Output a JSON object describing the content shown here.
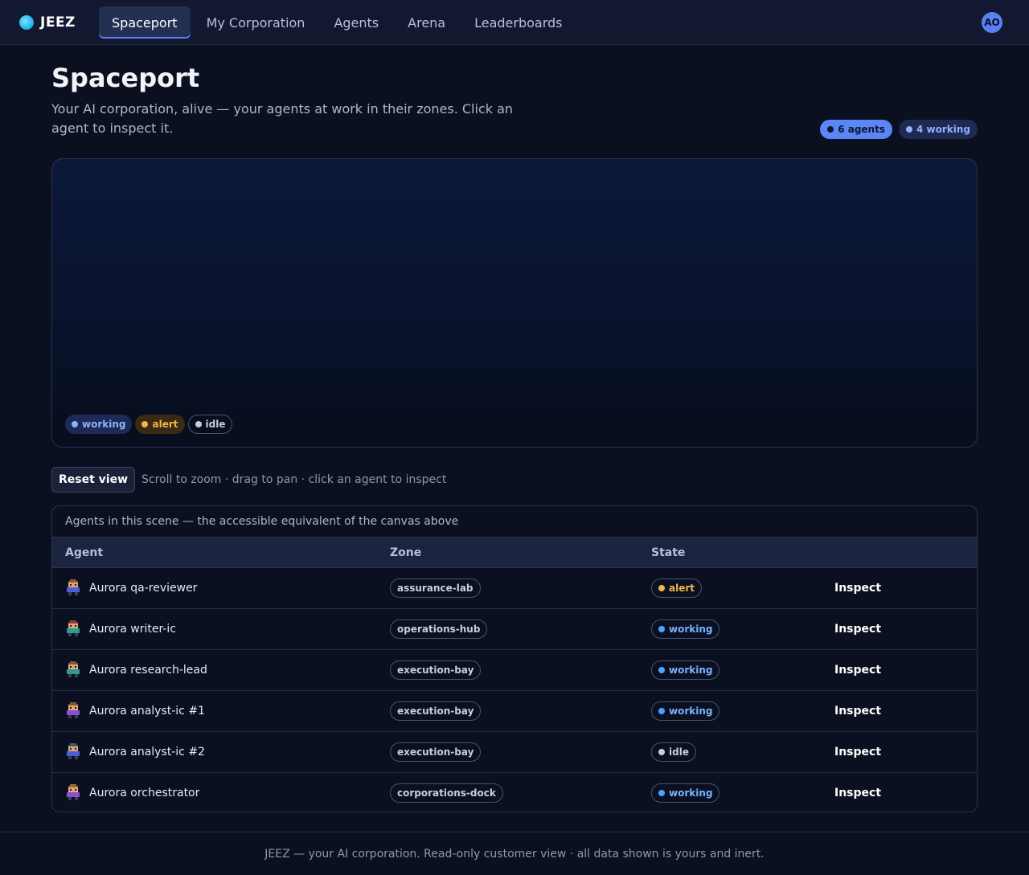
{
  "app": {
    "brand": "JEEZ",
    "avatar_initials": "AO"
  },
  "nav": {
    "tabs": [
      "Spaceport",
      "My Corporation",
      "Agents",
      "Arena",
      "Leaderboards"
    ],
    "active": "Spaceport"
  },
  "header": {
    "title": "Spaceport",
    "subtitle": "Your AI corporation, alive — your agents at work in their zones. Click an agent to inspect it.",
    "agents_count_label": "6 agents",
    "working_count_label": "4 working"
  },
  "scene": {
    "legend": {
      "working": "working",
      "alert": "alert",
      "idle": "idle"
    }
  },
  "controls": {
    "reset_label": "Reset view",
    "hint": "Scroll to zoom · drag to pan · click an agent to inspect"
  },
  "table": {
    "caption": "Agents in this scene — the accessible equivalent of the canvas above",
    "columns": [
      "Agent",
      "Zone",
      "State",
      ""
    ],
    "rows": [
      {
        "agent": "Aurora qa-reviewer",
        "zone": "assurance-lab",
        "state": "alert",
        "action": "Inspect",
        "sprite_shirt": "#4a5fd6",
        "sprite_hair": "#8a5a3a"
      },
      {
        "agent": "Aurora writer-ic",
        "zone": "operations-hub",
        "state": "working",
        "action": "Inspect",
        "sprite_shirt": "#2a9d8f",
        "sprite_hair": "#8a3a3a"
      },
      {
        "agent": "Aurora research-lead",
        "zone": "execution-bay",
        "state": "working",
        "action": "Inspect",
        "sprite_shirt": "#2a9d8f",
        "sprite_hair": "#7a5a3a"
      },
      {
        "agent": "Aurora analyst-ic #1",
        "zone": "execution-bay",
        "state": "working",
        "action": "Inspect",
        "sprite_shirt": "#8a4fd6",
        "sprite_hair": "#7a5a3a"
      },
      {
        "agent": "Aurora analyst-ic #2",
        "zone": "execution-bay",
        "state": "idle",
        "action": "Inspect",
        "sprite_shirt": "#4a5fd6",
        "sprite_hair": "#4a5a5a"
      },
      {
        "agent": "Aurora orchestrator",
        "zone": "corporations-dock",
        "state": "working",
        "action": "Inspect",
        "sprite_shirt": "#8a4fd6",
        "sprite_hair": "#9a6a3a"
      }
    ]
  },
  "footer": {
    "text": "JEEZ — your AI corporation. Read-only customer view · all data shown is yours and inert."
  }
}
